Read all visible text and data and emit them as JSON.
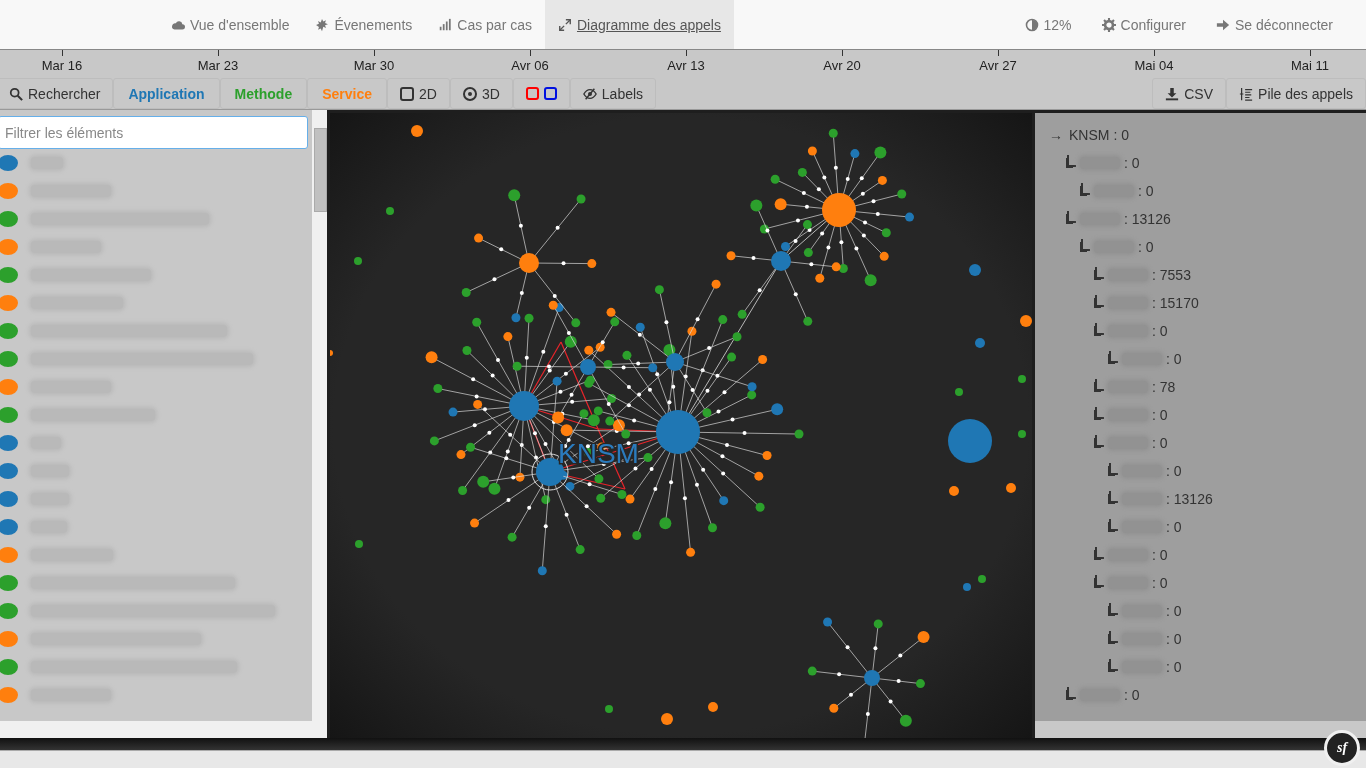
{
  "nav": {
    "items": [
      {
        "label": "Vue d'ensemble",
        "selected": false
      },
      {
        "label": "Évenements",
        "selected": false
      },
      {
        "label": "Cas par cas",
        "selected": false
      },
      {
        "label": "Diagramme des appels",
        "selected": true
      }
    ],
    "right": [
      {
        "label": "12%"
      },
      {
        "label": "Configurer"
      },
      {
        "label": "Se déconnecter"
      }
    ]
  },
  "timeline": {
    "ticks": [
      "Mar 16",
      "Mar 23",
      "Mar 30",
      "Avr 06",
      "Avr 13",
      "Avr 20",
      "Avr 27",
      "Mai 04",
      "Mai 11"
    ]
  },
  "toolbar": {
    "left": [
      {
        "kind": "search",
        "label": "Rechercher"
      },
      {
        "kind": "type",
        "label": "Application",
        "color": "#1f77b4"
      },
      {
        "kind": "type",
        "label": "Methode",
        "color": "#2ca02c"
      },
      {
        "kind": "type",
        "label": "Service",
        "color": "#ff7f0e"
      },
      {
        "kind": "radio",
        "label": "2D",
        "selected": false
      },
      {
        "kind": "radio",
        "label": "3D",
        "selected": true
      },
      {
        "kind": "colors"
      },
      {
        "kind": "labels",
        "label": "Labels"
      }
    ],
    "right": [
      {
        "kind": "download",
        "label": "CSV"
      },
      {
        "kind": "stack",
        "label": "Pile des appels"
      }
    ]
  },
  "filter": {
    "placeholder": "Filtrer les éléments"
  },
  "elements": [
    {
      "color": "#1f77b4",
      "redacted": true
    },
    {
      "color": "#ff7f0e",
      "redacted": true
    },
    {
      "color": "#2ca02c",
      "redacted": true
    },
    {
      "color": "#ff7f0e",
      "redacted": true
    },
    {
      "color": "#2ca02c",
      "redacted": true
    },
    {
      "color": "#ff7f0e",
      "redacted": true
    },
    {
      "color": "#2ca02c",
      "redacted": true
    },
    {
      "color": "#2ca02c",
      "redacted": true
    },
    {
      "color": "#ff7f0e",
      "redacted": true
    },
    {
      "color": "#2ca02c",
      "redacted": true
    },
    {
      "color": "#1f77b4",
      "redacted": true
    },
    {
      "color": "#1f77b4",
      "redacted": true
    },
    {
      "color": "#1f77b4",
      "redacted": true
    },
    {
      "color": "#1f77b4",
      "redacted": true
    },
    {
      "color": "#ff7f0e",
      "redacted": true
    },
    {
      "color": "#2ca02c",
      "redacted": true
    },
    {
      "color": "#2ca02c",
      "redacted": true
    },
    {
      "color": "#ff7f0e",
      "redacted": true
    },
    {
      "color": "#2ca02c",
      "redacted": true
    },
    {
      "color": "#ff7f0e",
      "redacted": true
    }
  ],
  "graph": {
    "focus_label": "KNSM"
  },
  "call_tree": {
    "marker": "→",
    "name": "KNSM",
    "value": ": 0",
    "children": [
      {
        "redacted": true,
        "value": ": 0",
        "children": [
          {
            "redacted": true,
            "value": ": 0"
          }
        ]
      },
      {
        "redacted": true,
        "value": ": 13126",
        "children": [
          {
            "redacted": true,
            "value": ": 0",
            "children": [
              {
                "redacted": true,
                "value": ": 7553"
              },
              {
                "redacted": true,
                "value": ": 15170"
              },
              {
                "redacted": true,
                "value": ": 0",
                "children": [
                  {
                    "redacted": true,
                    "value": ": 0"
                  }
                ]
              },
              {
                "redacted": true,
                "value": ": 78"
              },
              {
                "redacted": true,
                "value": ": 0"
              },
              {
                "redacted": true,
                "value": ": 0",
                "children": [
                  {
                    "redacted": true,
                    "value": ": 0"
                  },
                  {
                    "redacted": true,
                    "value": ": 13126"
                  },
                  {
                    "redacted": true,
                    "value": ": 0"
                  }
                ]
              },
              {
                "redacted": true,
                "value": ": 0"
              },
              {
                "redacted": true,
                "value": ": 0",
                "children": [
                  {
                    "redacted": true,
                    "value": ": 0"
                  },
                  {
                    "redacted": true,
                    "value": ": 0"
                  },
                  {
                    "redacted": true,
                    "value": ": 0"
                  }
                ]
              }
            ]
          }
        ]
      },
      {
        "redacted": true,
        "value": ": 0"
      }
    ]
  },
  "badge": {
    "label": "sf"
  }
}
